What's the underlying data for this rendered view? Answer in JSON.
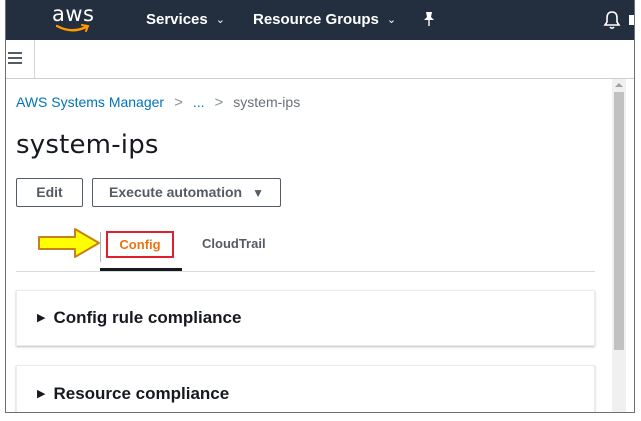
{
  "topnav": {
    "logo_text": "aws",
    "services_label": "Services",
    "resource_groups_label": "Resource Groups",
    "chevron": "⌄",
    "pin_icon": "pushpin-icon",
    "bell_icon": "bell-icon"
  },
  "menubar": {
    "hamburger_icon": "hamburger-icon"
  },
  "breadcrumb": {
    "root": "AWS Systems Manager",
    "middle": "...",
    "current": "system-ips",
    "separator": ">"
  },
  "page": {
    "title": "system-ips",
    "edit_label": "Edit",
    "execute_label": "Execute automation",
    "execute_caret": "▼"
  },
  "tabs": [
    {
      "label": "Config",
      "active": true
    },
    {
      "label": "CloudTrail",
      "active": false
    }
  ],
  "panels": [
    {
      "title": "Config rule compliance"
    },
    {
      "title": "Resource compliance"
    }
  ],
  "panel_toggle": "▶",
  "colors": {
    "nav_bg": "#232f3e",
    "link": "#0073bb",
    "active_tab_text": "#ec7211",
    "highlight_border": "#e0202e",
    "arrow_fill": "#ffff00",
    "arrow_stroke": "#c8801a"
  }
}
